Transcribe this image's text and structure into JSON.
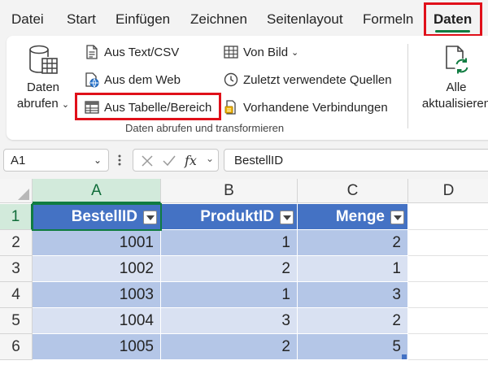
{
  "menu": {
    "tabs": [
      {
        "label": "Datei"
      },
      {
        "label": "Start"
      },
      {
        "label": "Einfügen"
      },
      {
        "label": "Zeichnen"
      },
      {
        "label": "Seitenlayout"
      },
      {
        "label": "Formeln"
      },
      {
        "label": "Daten"
      }
    ],
    "active": "Daten"
  },
  "ribbon": {
    "get_data": {
      "line1": "Daten",
      "line2": "abrufen"
    },
    "from_text_csv": "Aus Text/CSV",
    "from_web": "Aus dem Web",
    "from_table_range": "Aus Tabelle/Bereich",
    "from_picture": "Von Bild",
    "recent_sources": "Zuletzt verwendete Quellen",
    "existing_connections": "Vorhandene Verbindungen",
    "group_label": "Daten abrufen und transformieren",
    "refresh_all": {
      "line1": "Alle",
      "line2": "aktualisieren"
    }
  },
  "formula_bar": {
    "name_box": "A1",
    "formula": "BestellID"
  },
  "sheet": {
    "columns": [
      "A",
      "B",
      "C",
      "D"
    ],
    "rows": [
      "1",
      "2",
      "3",
      "4",
      "5",
      "6"
    ],
    "table": {
      "headers": [
        "BestellID",
        "ProduktID",
        "Menge"
      ],
      "rows": [
        [
          "1001",
          "1",
          "2"
        ],
        [
          "1002",
          "2",
          "1"
        ],
        [
          "1003",
          "1",
          "3"
        ],
        [
          "1004",
          "3",
          "2"
        ],
        [
          "1005",
          "2",
          "5"
        ]
      ]
    }
  },
  "colors": {
    "accent": "#107c41",
    "highlight": "#e0101a",
    "table_header": "#4472c4",
    "band_dark": "#b4c6e7",
    "band_light": "#d9e1f2"
  }
}
